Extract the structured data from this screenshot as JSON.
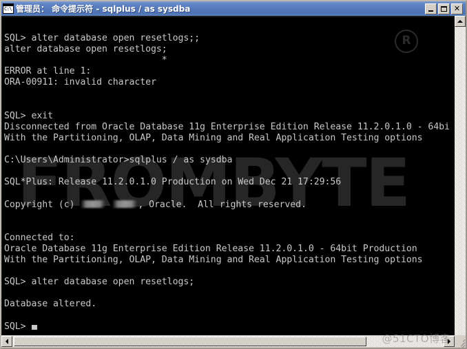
{
  "window": {
    "title": "管理员： 命令提示符 - sqlplus  / as sysdba",
    "icon": "console-icon",
    "icon_text": "C:\\.",
    "minimize_label": "_",
    "maximize_label": "□",
    "close_label": "✕",
    "titlebar_color": "#5579ba",
    "console_bg": "#000000",
    "console_fg": "#c8c8c8",
    "chrome_color": "#d4d0c8"
  },
  "terminal": {
    "lines": [
      "",
      "SQL> alter database open resetlogs;;",
      "alter database open resetlogs;",
      "                             *",
      "ERROR at line 1:",
      "ORA-00911: invalid character",
      "",
      "",
      "SQL> exit",
      "Disconnected from Oracle Database 11g Enterprise Edition Release 11.2.0.1.0 - 64bi",
      "With the Partitioning, OLAP, Data Mining and Real Application Testing options",
      "",
      "C:\\Users\\Administrator>sqlplus / as sysdba",
      "",
      "SQL*Plus: Release 11.2.0.1.0 Production on Wed Dec 21 17:29:56",
      "",
      "COPYRIGHT_REDACTED",
      "",
      "",
      "Connected to:",
      "Oracle Database 11g Enterprise Edition Release 11.2.0.1.0 - 64bit Production",
      "With the Partitioning, OLAP, Data Mining and Real Application Testing options",
      "",
      "SQL> alter database open resetlogs;",
      "",
      "Database altered.",
      "",
      "SQL_PROMPT_CURSOR"
    ],
    "copyright_prefix": "Copyright (c) ",
    "copyright_suffix": ", Oracle.  All rights reserved.",
    "prompt": "SQL>",
    "cursor": "block"
  },
  "watermarks": {
    "center": "FROMBYTE",
    "center_mark": "R",
    "corner": "@51CTO博客"
  },
  "scrollbars": {
    "vertical": {
      "up_arrow": "▲",
      "down_arrow": "▼"
    },
    "horizontal": {
      "left_arrow": "◄",
      "right_arrow": "►"
    }
  }
}
